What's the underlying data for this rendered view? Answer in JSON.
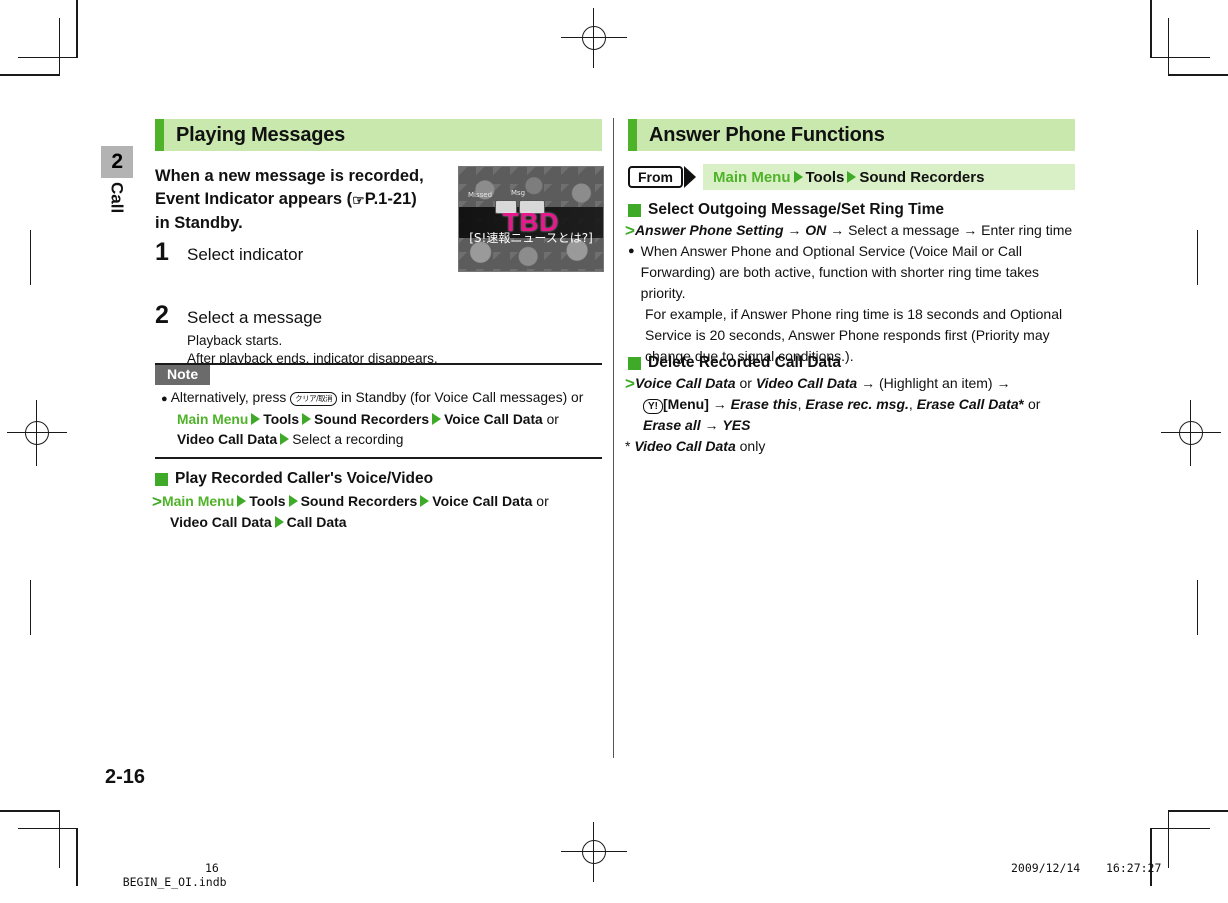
{
  "page": {
    "folio": "2-16",
    "chapter_number": "2",
    "chapter_label": "Call"
  },
  "left_column": {
    "section_title": "Playing Messages",
    "lead_lines": [
      "When a new message is recorded,",
      "Event Indicator appears (",
      "P.1-21)",
      "in Standby."
    ],
    "lead_ref_icon": "pointing-hand-icon",
    "lead_ref": "P.1-21",
    "steps": [
      {
        "num": "1",
        "title": "Select indicator",
        "subs": []
      },
      {
        "num": "2",
        "title": "Select a message",
        "subs": [
          "Playback starts.",
          "After playback ends, indicator disappears."
        ]
      }
    ],
    "screenshot": {
      "tbd_text": "TBD",
      "caption_jp": "[S!速報ニュースとは?]",
      "mini_labels": [
        "Missed",
        "Msg"
      ]
    },
    "note": {
      "tag": "Note",
      "bullet": "●",
      "line1_a": "Alternatively, press",
      "key_icon_label": "クリア/取消",
      "line1_b": "in Standby (for Voice Call messages) or",
      "line2": [
        "Main Menu",
        "Tools",
        "Sound Recorders",
        "Voice Call Data"
      ],
      "line2_tail": "or",
      "line3": [
        "Video Call Data"
      ],
      "line3_tail": "Select a recording"
    },
    "subsection": {
      "heading": "Play Recorded Caller's Voice/Video",
      "path_line1": [
        "Main Menu",
        "Tools",
        "Sound Recorders",
        "Voice Call Data"
      ],
      "path_line1_tail": "or",
      "path_line2": [
        "Video Call Data",
        "Call Data"
      ]
    }
  },
  "right_column": {
    "section_title": "Answer Phone Functions",
    "from_row": {
      "label": "From",
      "path": [
        "Main Menu",
        "Tools",
        "Sound Recorders"
      ]
    },
    "blocks": [
      {
        "heading": "Select Outgoing Message/Set Ring Time",
        "proc_parts": [
          {
            "text": "Answer Phone Setting",
            "style": "bi"
          },
          {
            "text": " → ",
            "style": "plain"
          },
          {
            "text": "ON",
            "style": "bi"
          },
          {
            "text": " → Select a message → Enter ring time",
            "style": "plain"
          }
        ],
        "bullets": [
          "When Answer Phone and Optional Service (Voice Mail or Call Forwarding) are both active, function with shorter ring time takes priority.",
          "For example, if Answer Phone ring time is 18 seconds and Optional Service is 20 seconds, Answer Phone responds first (Priority may change due to signal conditions.)."
        ]
      },
      {
        "heading": "Delete Recorded Call Data",
        "proc_lines": [
          "Voice Call Data or Video Call Data → (Highlight an item) →",
          "[Menu] → Erase this, Erase rec. msg., Erase Call Data* or",
          "Erase all → YES"
        ],
        "menu_icon_label": "Y!",
        "footnote": "* Video Call Data only",
        "footnote_italic": "Video Call Data",
        "footnote_tail": "only"
      }
    ]
  },
  "footer": {
    "filename": "BEGIN_E_OI.indb",
    "page_number": "16",
    "date": "2009/12/14",
    "time": "16:27:27"
  },
  "colors": {
    "header_bg": "#c9e8ae",
    "header_bar": "#4fb32a",
    "accent_green": "#4fb32a",
    "note_tag_bg": "#6b6b6b",
    "chapter_tab_bg": "#b3b3b3",
    "from_path_bg": "#d9efc6",
    "tbd_pink": "#e8178c"
  }
}
